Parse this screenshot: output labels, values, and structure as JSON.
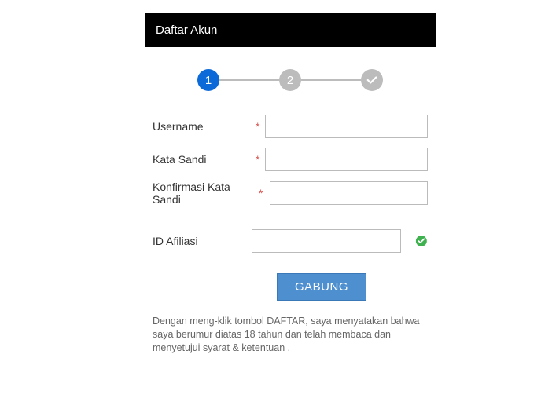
{
  "header": {
    "title": "Daftar Akun"
  },
  "steps": {
    "s1": "1",
    "s2": "2"
  },
  "form": {
    "username_label": "Username",
    "username_value": "",
    "password_label": "Kata Sandi",
    "password_value": "",
    "confirm_label": "Konfirmasi Kata Sandi",
    "confirm_value": "",
    "affiliate_label": "ID Afiliasi",
    "affiliate_value": "",
    "required_mark": "*"
  },
  "button": {
    "submit": "GABUNG"
  },
  "disclaimer": {
    "text": "Dengan meng-klik tombol DAFTAR, saya menyatakan bahwa saya berumur diatas 18 tahun dan telah membaca dan menyetujui ",
    "terms": "syarat & ketentuan",
    "dot": " ."
  }
}
